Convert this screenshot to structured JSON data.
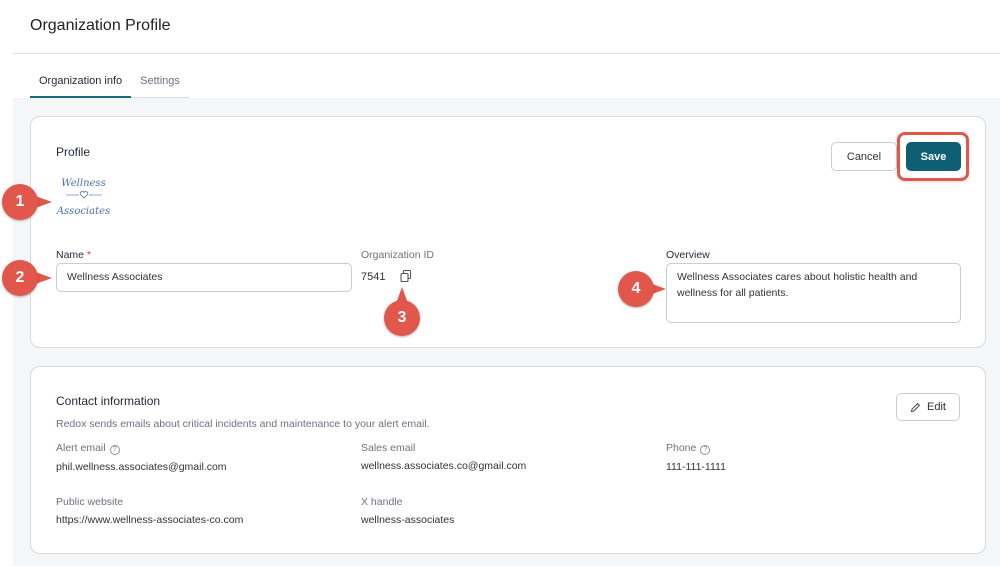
{
  "page": {
    "title": "Organization Profile"
  },
  "tabs": [
    {
      "label": "Organization info",
      "active": true
    },
    {
      "label": "Settings",
      "active": false
    }
  ],
  "profile": {
    "title": "Profile",
    "cancel_label": "Cancel",
    "save_label": "Save",
    "logo_lines": [
      "Wellness",
      "Associates"
    ],
    "name_label": "Name",
    "name_required": "*",
    "name_value": "Wellness Associates",
    "org_id_label": "Organization ID",
    "org_id_value": "7541",
    "overview_label": "Overview",
    "overview_value": "Wellness Associates cares about holistic health and wellness for all patients."
  },
  "contact": {
    "title": "Contact information",
    "description": "Redox sends emails about critical incidents and maintenance to your alert email.",
    "edit_label": "Edit",
    "alert_email_label": "Alert email",
    "alert_email_value": "phil.wellness.associates@gmail.com",
    "sales_email_label": "Sales email",
    "sales_email_value": "wellness.associates.co@gmail.com",
    "phone_label": "Phone",
    "phone_value": "111-111-1111",
    "website_label": "Public website",
    "website_value": "https://www.wellness-associates-co.com",
    "x_handle_label": "X handle",
    "x_handle_value": "wellness-associates"
  },
  "markers": [
    "1",
    "2",
    "3",
    "4"
  ],
  "colors": {
    "accent": "#0e5f74",
    "marker": "#e2574c"
  }
}
